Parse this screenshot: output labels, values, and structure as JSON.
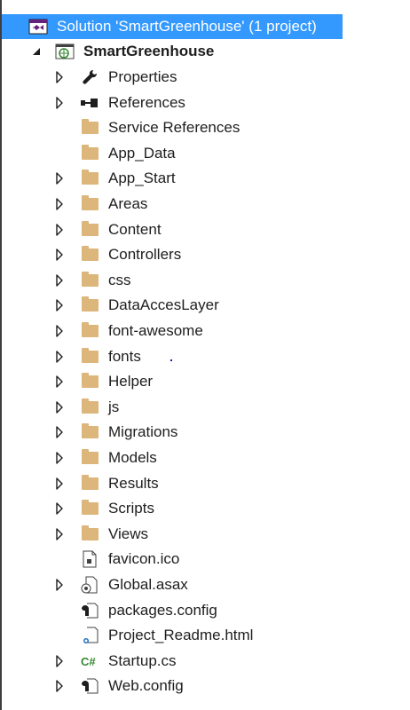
{
  "solution": {
    "label": "Solution 'SmartGreenhouse' (1 project)"
  },
  "project": {
    "label": "SmartGreenhouse"
  },
  "items": [
    {
      "label": "Properties",
      "icon": "wrench-icon",
      "expandable": true
    },
    {
      "label": "References",
      "icon": "references-icon",
      "expandable": true
    },
    {
      "label": "Service References",
      "icon": "folder-icon",
      "expandable": false
    },
    {
      "label": "App_Data",
      "icon": "folder-icon",
      "expandable": false
    },
    {
      "label": "App_Start",
      "icon": "folder-icon",
      "expandable": true
    },
    {
      "label": "Areas",
      "icon": "folder-icon",
      "expandable": true
    },
    {
      "label": "Content",
      "icon": "folder-icon",
      "expandable": true
    },
    {
      "label": "Controllers",
      "icon": "folder-icon",
      "expandable": true
    },
    {
      "label": "css",
      "icon": "folder-icon",
      "expandable": true
    },
    {
      "label": "DataAccesLayer",
      "icon": "folder-icon",
      "expandable": true
    },
    {
      "label": "font-awesome",
      "icon": "folder-icon",
      "expandable": true
    },
    {
      "label": "fonts",
      "icon": "folder-icon",
      "expandable": true
    },
    {
      "label": "Helper",
      "icon": "folder-icon",
      "expandable": true
    },
    {
      "label": "js",
      "icon": "folder-icon",
      "expandable": true
    },
    {
      "label": "Migrations",
      "icon": "folder-icon",
      "expandable": true
    },
    {
      "label": "Models",
      "icon": "folder-icon",
      "expandable": true
    },
    {
      "label": "Results",
      "icon": "folder-icon",
      "expandable": true
    },
    {
      "label": "Scripts",
      "icon": "folder-icon",
      "expandable": true
    },
    {
      "label": "Views",
      "icon": "folder-icon",
      "expandable": true
    },
    {
      "label": "favicon.ico",
      "icon": "image-file-icon",
      "expandable": false
    },
    {
      "label": "Global.asax",
      "icon": "global-asax-icon",
      "expandable": true
    },
    {
      "label": "packages.config",
      "icon": "config-file-icon",
      "expandable": false
    },
    {
      "label": "Project_Readme.html",
      "icon": "html-file-icon",
      "expandable": false
    },
    {
      "label": "Startup.cs",
      "icon": "csharp-file-icon",
      "expandable": true
    },
    {
      "label": "Web.config",
      "icon": "config-file-icon",
      "expandable": true
    }
  ],
  "colors": {
    "selection": "#3399ff",
    "folder": "#dcb67a",
    "text": "#1e1e1e",
    "csharp": "#368832"
  }
}
